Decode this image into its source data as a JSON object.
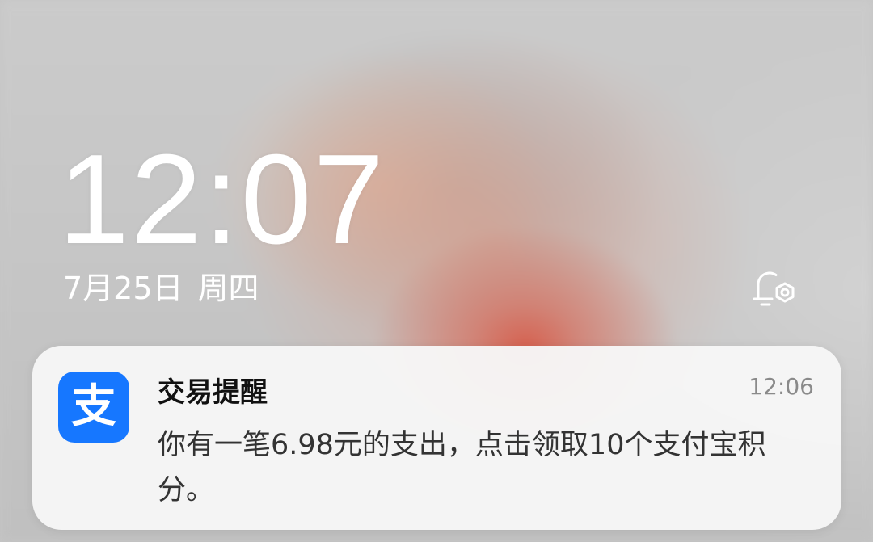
{
  "lockscreen": {
    "time": "12:07",
    "date": "7月25日",
    "weekday": "周四",
    "notification_settings_icon": "bell-gear-icon"
  },
  "notification": {
    "app_icon": "alipay-icon",
    "app_icon_glyph": "支",
    "app_icon_color": "#1677ff",
    "title": "交易提醒",
    "time": "12:06",
    "body": "你有一笔6.98元的支出，点击领取10个支付宝积分。"
  }
}
